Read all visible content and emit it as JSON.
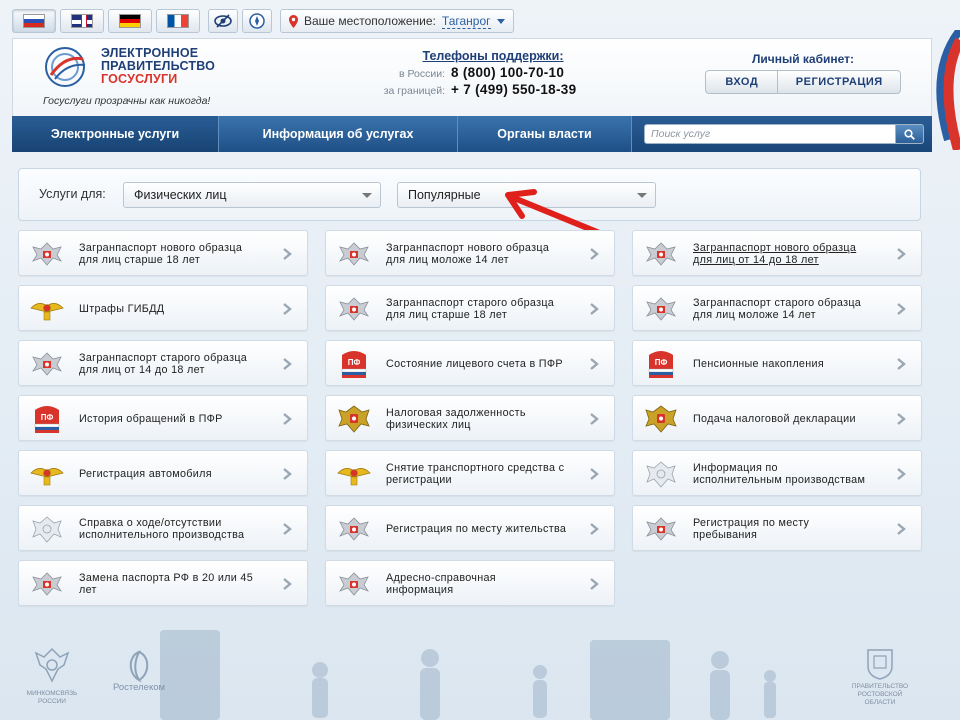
{
  "languages": [
    "ru",
    "en",
    "de",
    "fr"
  ],
  "location": {
    "label": "Ваше местоположение:",
    "city": "Таганрог"
  },
  "brand": {
    "line1": "ЭЛЕКТРОННОЕ",
    "line2": "ПРАВИТЕЛЬСТВО",
    "line3": "ГОСУСЛУГИ",
    "slogan": "Госуслуги прозрачны как никогда!"
  },
  "support": {
    "title": "Телефоны поддержки",
    "colon": ":",
    "russia_label": "в России:",
    "russia_phone": "8 (800) 100-70-10",
    "abroad_label": "за границей:",
    "abroad_phone": "+ 7 (499) 550-18-39"
  },
  "cabinet": {
    "title": "Личный кабинет:",
    "login": "ВХОД",
    "register": "РЕГИСТРАЦИЯ"
  },
  "nav": {
    "services": "Электронные услуги",
    "info": "Информация об услугах",
    "authorities": "Органы власти",
    "search_placeholder": "Поиск услуг"
  },
  "filter": {
    "label": "Услуги для:",
    "audience": "Физических лиц",
    "category": "Популярные"
  },
  "services": [
    {
      "line1": "Загранпаспорт нового образца",
      "line2": "для лиц старше 18 лет",
      "icon": "eagle-emblem-icon"
    },
    {
      "line1": "Загранпаспорт нового образца",
      "line2": "для лиц моложе 14 лет",
      "icon": "eagle-emblem-icon"
    },
    {
      "line1": "Загранпаспорт нового образца",
      "line2": "для лиц от 14 до 18 лет",
      "icon": "eagle-emblem-icon"
    },
    {
      "line1": "Штрафы ГИБДД",
      "line2": "",
      "icon": "gibdd-eagle-icon"
    },
    {
      "line1": "Загранпаспорт старого образца",
      "line2": "для лиц старше 18 лет",
      "icon": "eagle-emblem-icon"
    },
    {
      "line1": "Загранпаспорт старого образца",
      "line2": "для лиц моложе 14 лет",
      "icon": "eagle-emblem-icon"
    },
    {
      "line1": "Загранпаспорт старого образца",
      "line2": "для лиц от 14 до 18 лет",
      "icon": "eagle-emblem-icon"
    },
    {
      "line1": "Состояние лицевого счета в ПФР",
      "line2": "",
      "icon": "pfr-logo-icon"
    },
    {
      "line1": "Пенсионные накопления",
      "line2": "",
      "icon": "pfr-logo-icon"
    },
    {
      "line1": "История обращений в ПФР",
      "line2": "",
      "icon": "pfr-logo-icon"
    },
    {
      "line1": "Налоговая задолженность",
      "line2": "физических лиц",
      "icon": "tax-eagle-icon"
    },
    {
      "line1": "Подача налоговой декларации",
      "line2": "",
      "icon": "tax-eagle-icon"
    },
    {
      "line1": "Регистрация автомобиля",
      "line2": "",
      "icon": "gibdd-eagle-icon"
    },
    {
      "line1": "Снятие транспортного средства с",
      "line2": "регистрации",
      "icon": "gibdd-eagle-icon"
    },
    {
      "line1": "Информация по",
      "line2": "исполнительным производствам",
      "icon": "bailiff-emblem-icon"
    },
    {
      "line1": "Справка о ходе/отсутствии",
      "line2": "исполнительного производства",
      "icon": "bailiff-emblem-icon"
    },
    {
      "line1": "Регистрация по месту жительства",
      "line2": "",
      "icon": "eagle-emblem-icon"
    },
    {
      "line1": "Регистрация по месту",
      "line2": "пребывания",
      "icon": "eagle-emblem-icon"
    },
    {
      "line1": "Замена паспорта РФ в 20 или 45",
      "line2": "лет",
      "icon": "eagle-emblem-icon"
    },
    {
      "line1": "Адресно-справочная",
      "line2": "информация",
      "icon": "eagle-emblem-icon"
    }
  ],
  "footer": {
    "minsvyaz_line1": "МИНКОМСВЯЗЬ",
    "minsvyaz_line2": "РОССИИ",
    "rostelecom": "Ростелеком",
    "gov_line1": "ПРАВИТЕЛЬСТВО",
    "gov_line2": "РОСТОВСКОЙ",
    "gov_line3": "ОБЛАСТИ"
  },
  "colors": {
    "nav_blue": "#1e4f86",
    "brand_blue": "#1f3f77",
    "brand_red": "#d9342b",
    "arrow_red": "#e0201b"
  }
}
